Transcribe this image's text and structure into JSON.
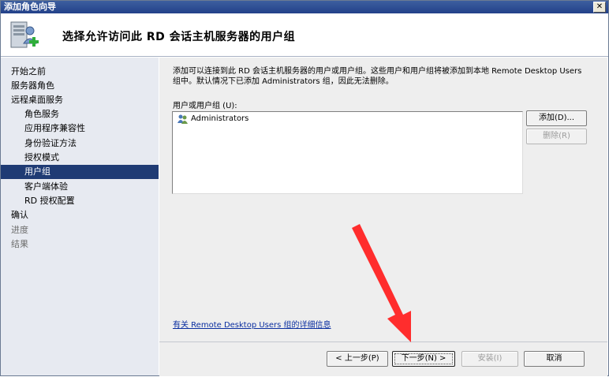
{
  "window": {
    "title": "添加角色向导",
    "close_glyph": "✕"
  },
  "header": {
    "title": "选择允许访问此 RD 会话主机服务器的用户组",
    "icon": "server-users-add-icon"
  },
  "sidebar": {
    "items": [
      {
        "label": "开始之前",
        "level": 0,
        "state": "normal"
      },
      {
        "label": "服务器角色",
        "level": 0,
        "state": "normal"
      },
      {
        "label": "远程桌面服务",
        "level": 0,
        "state": "normal"
      },
      {
        "label": "角色服务",
        "level": 1,
        "state": "normal"
      },
      {
        "label": "应用程序兼容性",
        "level": 1,
        "state": "normal"
      },
      {
        "label": "身份验证方法",
        "level": 1,
        "state": "normal"
      },
      {
        "label": "授权模式",
        "level": 1,
        "state": "normal"
      },
      {
        "label": "用户组",
        "level": 1,
        "state": "active"
      },
      {
        "label": "客户端体验",
        "level": 1,
        "state": "normal"
      },
      {
        "label": "RD 授权配置",
        "level": 1,
        "state": "normal"
      },
      {
        "label": "确认",
        "level": 0,
        "state": "normal"
      },
      {
        "label": "进度",
        "level": 0,
        "state": "disabled"
      },
      {
        "label": "结果",
        "level": 0,
        "state": "disabled"
      }
    ]
  },
  "main": {
    "description": "添加可以连接到此 RD 会话主机服务器的用户或用户组。这些用户和用户组将被添加到本地 Remote Desktop Users 组中。默认情况下已添加 Administrators 组，因此无法删除。",
    "list_label": "用户或用户组 (U):",
    "list_items": [
      "Administrators"
    ],
    "add_button": "添加(D)...",
    "remove_button": "删除(R)",
    "info_link": "有关 Remote Desktop Users 组的详细信息"
  },
  "footer": {
    "prev_button": "< 上一步(P)",
    "next_button": "下一步(N) >",
    "install_button": "安装(I)",
    "cancel_button": "取消"
  },
  "colors": {
    "titlebar": "#23418a",
    "sidebar_bg": "#e7eaf1",
    "active_item": "#1f3b74",
    "content_bg": "#eeeeee",
    "arrow": "#ff2d2d"
  }
}
